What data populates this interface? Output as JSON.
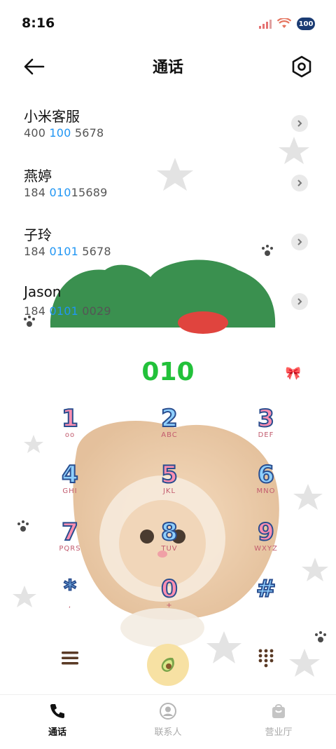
{
  "status_bar": {
    "time": "8:16",
    "battery": "100"
  },
  "header": {
    "title": "通话"
  },
  "calls": [
    {
      "name": "小米客服",
      "number_parts": [
        "400",
        " 100 ",
        "5678"
      ],
      "highlight": [
        false,
        true,
        false
      ]
    },
    {
      "name": "燕婷",
      "number_parts": [
        "184 ",
        "010",
        "15689"
      ],
      "highlight": [
        false,
        true,
        false
      ]
    },
    {
      "name": "子玲",
      "number_parts": [
        "184 ",
        "0101",
        " 5678"
      ],
      "highlight": [
        false,
        true,
        false
      ]
    },
    {
      "name": "Jason",
      "number_parts": [
        "184 ",
        "0101",
        " 0029"
      ],
      "highlight": [
        false,
        true,
        false
      ]
    }
  ],
  "dial": {
    "input": "010"
  },
  "keys": [
    {
      "digit": "1",
      "letters": "oo"
    },
    {
      "digit": "2",
      "letters": "ABC"
    },
    {
      "digit": "3",
      "letters": "DEF"
    },
    {
      "digit": "4",
      "letters": "GHI"
    },
    {
      "digit": "5",
      "letters": "JKL"
    },
    {
      "digit": "6",
      "letters": "MNO"
    },
    {
      "digit": "7",
      "letters": "PQRS"
    },
    {
      "digit": "8",
      "letters": "TUV"
    },
    {
      "digit": "9",
      "letters": "WXYZ"
    },
    {
      "digit": "*",
      "letters": ","
    },
    {
      "digit": "0",
      "letters": "+"
    },
    {
      "digit": "#",
      "letters": ""
    }
  ],
  "tabs": [
    {
      "label": "通话"
    },
    {
      "label": "联系人"
    },
    {
      "label": "营业厅"
    }
  ],
  "colors": {
    "accent_green": "#22c13a",
    "highlight_blue": "#2196f3",
    "call_button": "#f7e1a3"
  }
}
